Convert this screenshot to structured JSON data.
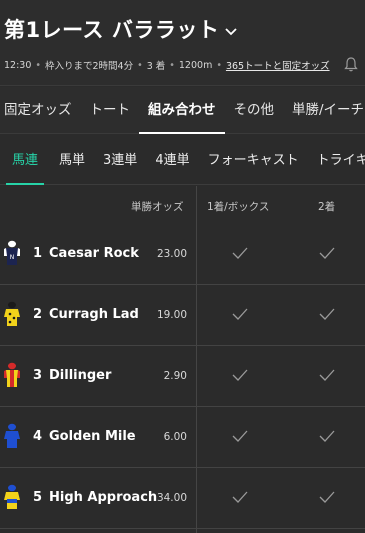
{
  "header": {
    "title": "第1レース バララット",
    "sub": {
      "time": "12:30",
      "countdown": "枠入りまで2時間4分",
      "placings": "3 着",
      "distance": "1200m",
      "tote_link": "365トートと固定オッズ"
    }
  },
  "tabs": [
    {
      "label": "固定オッズ",
      "active": false
    },
    {
      "label": "トート",
      "active": false
    },
    {
      "label": "組み合わせ",
      "active": true
    },
    {
      "label": "その他",
      "active": false
    },
    {
      "label": "単勝/イーチウェイ",
      "active": false
    }
  ],
  "subtabs": [
    {
      "label": "馬連",
      "active": true
    },
    {
      "label": "馬単",
      "active": false
    },
    {
      "label": "3連単",
      "active": false
    },
    {
      "label": "4連単",
      "active": false
    },
    {
      "label": "フォーキャスト",
      "active": false
    },
    {
      "label": "トライキャスト",
      "active": false
    }
  ],
  "columns": {
    "odds": "単勝オッズ",
    "box": "1着/ボックス",
    "second": "2着"
  },
  "colors": {
    "accent": "#27d3a8",
    "background": "#2b2b2b",
    "divider": "#434343"
  },
  "runners": [
    {
      "number": "1",
      "name": "Caesar Rock",
      "odds": "23.00",
      "silk": "silk-navy-white-icon"
    },
    {
      "number": "2",
      "name": "Curragh Lad",
      "odds": "19.00",
      "silk": "silk-yellow-black-icon"
    },
    {
      "number": "3",
      "name": "Dillinger",
      "odds": "2.90",
      "silk": "silk-red-yellow-icon"
    },
    {
      "number": "4",
      "name": "Golden Mile",
      "odds": "6.00",
      "silk": "silk-royal-blue-icon"
    },
    {
      "number": "5",
      "name": "High Approach",
      "odds": "34.00",
      "silk": "silk-yellow-blue-icon"
    }
  ]
}
